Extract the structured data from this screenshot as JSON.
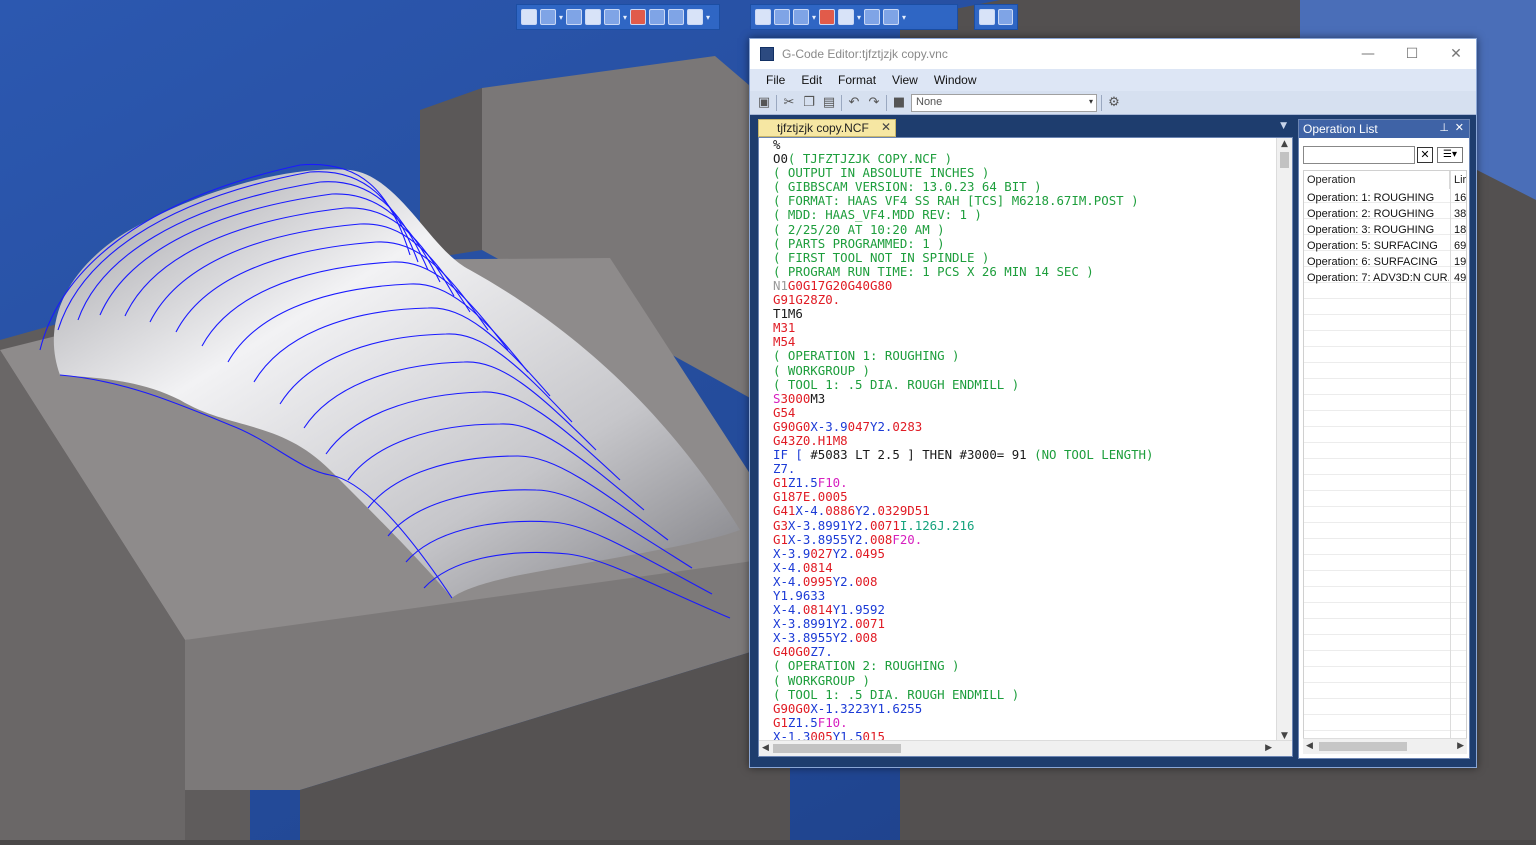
{
  "viewport": {
    "background_color": "#4a4848",
    "sky_color": "#2f5aa8",
    "toolpath_color": "#1a1aff"
  },
  "left_toolbar_icons": [
    "select-icon",
    "view-icon",
    "solid-icon",
    "wireframe-icon",
    "shade-icon",
    "color-icon",
    "axis-icon",
    "layer-icon",
    "grid-icon"
  ],
  "right_toolbar_icons": [
    "render-icon",
    "part-icon",
    "save-icon",
    "layout-icon",
    "palette-icon",
    "sphere-icon",
    "window-icon",
    "zoom-icon",
    "help-icon"
  ],
  "editor": {
    "title": "G-Code Editor:tjfztjzjk copy.vnc",
    "menu": [
      "File",
      "Edit",
      "Format",
      "View",
      "Window"
    ],
    "combo_value": "None",
    "tab_label": "tjfztjzjk copy.NCF",
    "code_lines": [
      [
        [
          "%",
          "k"
        ]
      ],
      [
        [
          "O0",
          "k"
        ],
        [
          "( TJFZTJZJK COPY.NCF )",
          "g"
        ]
      ],
      [
        [
          "( OUTPUT IN ABSOLUTE INCHES )",
          "g"
        ]
      ],
      [
        [
          "( GIBBSCAM VERSION: 13.0.23 64 BIT )",
          "g"
        ]
      ],
      [
        [
          "( FORMAT: HAAS VF4 SS RAH [TCS] M6218.67IM.POST )",
          "g"
        ]
      ],
      [
        [
          "( MDD: HAAS_VF4.MDD REV: 1 )",
          "g"
        ]
      ],
      [
        [
          "( 2/25/20 AT 10:20 AM )",
          "g"
        ]
      ],
      [
        [
          "( PARTS PROGRAMMED: 1 )",
          "g"
        ]
      ],
      [
        [
          "( FIRST TOOL NOT IN SPINDLE )",
          "g"
        ]
      ],
      [
        [
          "( PROGRAM RUN TIME: 1 PCS X 26 MIN 14 SEC )",
          "g"
        ]
      ],
      [
        [
          "N1",
          "n"
        ],
        [
          "G0G17G20G40G80",
          "r"
        ]
      ],
      [
        [
          "G91G28",
          "r"
        ],
        [
          "Z0.",
          "r"
        ]
      ],
      [
        [
          "T1M6",
          "k"
        ]
      ],
      [
        [
          "M31",
          "r"
        ]
      ],
      [
        [
          "M54",
          "r"
        ]
      ],
      [
        [
          "( OPERATION 1: ROUGHING )",
          "g"
        ]
      ],
      [
        [
          "( WORKGROUP )",
          "g"
        ]
      ],
      [
        [
          "( TOOL 1: .5 DIA. ROUGH ENDMILL )",
          "g"
        ]
      ],
      [
        [
          "S",
          "m"
        ],
        [
          "3000",
          "r"
        ],
        [
          "M3",
          "k"
        ]
      ],
      [
        [
          "G54",
          "r"
        ]
      ],
      [
        [
          "G90G0",
          "r"
        ],
        [
          "X-3.9",
          "b"
        ],
        [
          "047",
          "r"
        ],
        [
          "Y2.",
          "b"
        ],
        [
          "0283",
          "r"
        ]
      ],
      [
        [
          "G43",
          "r"
        ],
        [
          "Z0.",
          "r"
        ],
        [
          "H1M8",
          "r"
        ]
      ],
      [
        [
          "IF [ ",
          "b"
        ],
        [
          "#5083 LT 2.5 ] THEN #3000= 91 ",
          "k"
        ],
        [
          "(NO TOOL LENGTH)",
          "g"
        ]
      ],
      [
        [
          "Z7.",
          "b"
        ]
      ],
      [
        [
          "G1",
          "r"
        ],
        [
          "Z1.5",
          "b"
        ],
        [
          "F10.",
          "m"
        ]
      ],
      [
        [
          "G187E.0005",
          "r"
        ]
      ],
      [
        [
          "G41",
          "r"
        ],
        [
          "X-4.",
          "b"
        ],
        [
          "0886",
          "r"
        ],
        [
          "Y2.",
          "b"
        ],
        [
          "0329D51",
          "r"
        ]
      ],
      [
        [
          "G3",
          "r"
        ],
        [
          "X-3.8991Y2.",
          "b"
        ],
        [
          "0071",
          "r"
        ],
        [
          "I.126J.216",
          "t"
        ]
      ],
      [
        [
          "G1",
          "r"
        ],
        [
          "X-3.8955Y2.",
          "b"
        ],
        [
          "008",
          "r"
        ],
        [
          "F20.",
          "m"
        ]
      ],
      [
        [
          "X-3.9",
          "b"
        ],
        [
          "027",
          "r"
        ],
        [
          "Y2.",
          "b"
        ],
        [
          "0495",
          "r"
        ]
      ],
      [
        [
          "X-4.",
          "b"
        ],
        [
          "0814",
          "r"
        ]
      ],
      [
        [
          "X-4.",
          "b"
        ],
        [
          "0995",
          "r"
        ],
        [
          "Y2.",
          "b"
        ],
        [
          "008",
          "r"
        ]
      ],
      [
        [
          "Y1.9633",
          "b"
        ]
      ],
      [
        [
          "X-4.",
          "b"
        ],
        [
          "0814",
          "r"
        ],
        [
          "Y1.9592",
          "b"
        ]
      ],
      [
        [
          "X-3.8991Y2.",
          "b"
        ],
        [
          "0071",
          "r"
        ]
      ],
      [
        [
          "X-3.8955Y2.",
          "b"
        ],
        [
          "008",
          "r"
        ]
      ],
      [
        [
          "G40G0",
          "r"
        ],
        [
          "Z7.",
          "b"
        ]
      ],
      [
        [
          "( OPERATION 2: ROUGHING )",
          "g"
        ]
      ],
      [
        [
          "( WORKGROUP )",
          "g"
        ]
      ],
      [
        [
          "( TOOL 1: .5 DIA. ROUGH ENDMILL )",
          "g"
        ]
      ],
      [
        [
          "G90G0",
          "r"
        ],
        [
          "X-1.3223Y1.6255",
          "b"
        ]
      ],
      [
        [
          "G1",
          "r"
        ],
        [
          "Z1.5",
          "b"
        ],
        [
          "F10.",
          "m"
        ]
      ],
      [
        [
          "X-1.3",
          "b"
        ],
        [
          "005",
          "r"
        ],
        [
          "Y1.5",
          "b"
        ],
        [
          "015",
          "r"
        ]
      ]
    ],
    "syntax_colors": {
      "k": "#1a1a1a",
      "g": "#1d9e3c",
      "r": "#e01b24",
      "b": "#1c3bd6",
      "m": "#d61fbf",
      "n": "#9a9a9a",
      "t": "#16a37d"
    }
  },
  "operation_list": {
    "title": "Operation List",
    "col_operation": "Operation",
    "col_lines": "Lir",
    "rows": [
      {
        "name": "Operation: 1: ROUGHING",
        "lines": "16"
      },
      {
        "name": "Operation: 2: ROUGHING",
        "lines": "38"
      },
      {
        "name": "Operation: 3: ROUGHING",
        "lines": "18"
      },
      {
        "name": "Operation: 5: SURFACING",
        "lines": "69"
      },
      {
        "name": "Operation: 6: SURFACING",
        "lines": "19"
      },
      {
        "name": "Operation: 7: ADV3D:N CUR...",
        "lines": "49"
      }
    ]
  }
}
